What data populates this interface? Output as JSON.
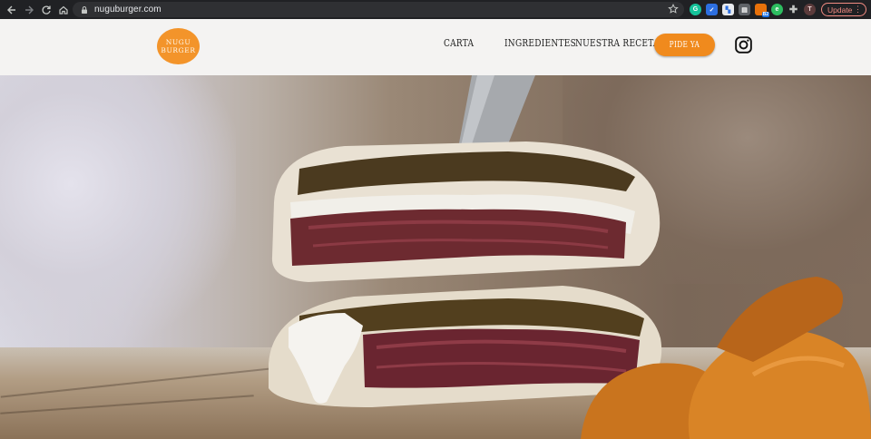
{
  "browser": {
    "url": "nuguburger.com",
    "update_label": "Update",
    "profile_initial": "T",
    "extensions": [
      "grammarly-icon",
      "extension-icon",
      "chart-extension-icon",
      "feedback-extension-icon",
      "badge-extension-icon",
      "evernote-icon",
      "puzzle-icon"
    ],
    "extension_badge": "B2"
  },
  "site": {
    "logo_line1": "NUGU",
    "logo_line2": "BURGER",
    "nav": {
      "carta": "CARTA",
      "ingredientes": "INGREDIENTES",
      "receta": "NUESTRA RECETA"
    },
    "cta_label": "PIDE YA",
    "accent_color": "#f08a1d"
  },
  "hero": {
    "image_description": "photo",
    "alt": "burger"
  }
}
